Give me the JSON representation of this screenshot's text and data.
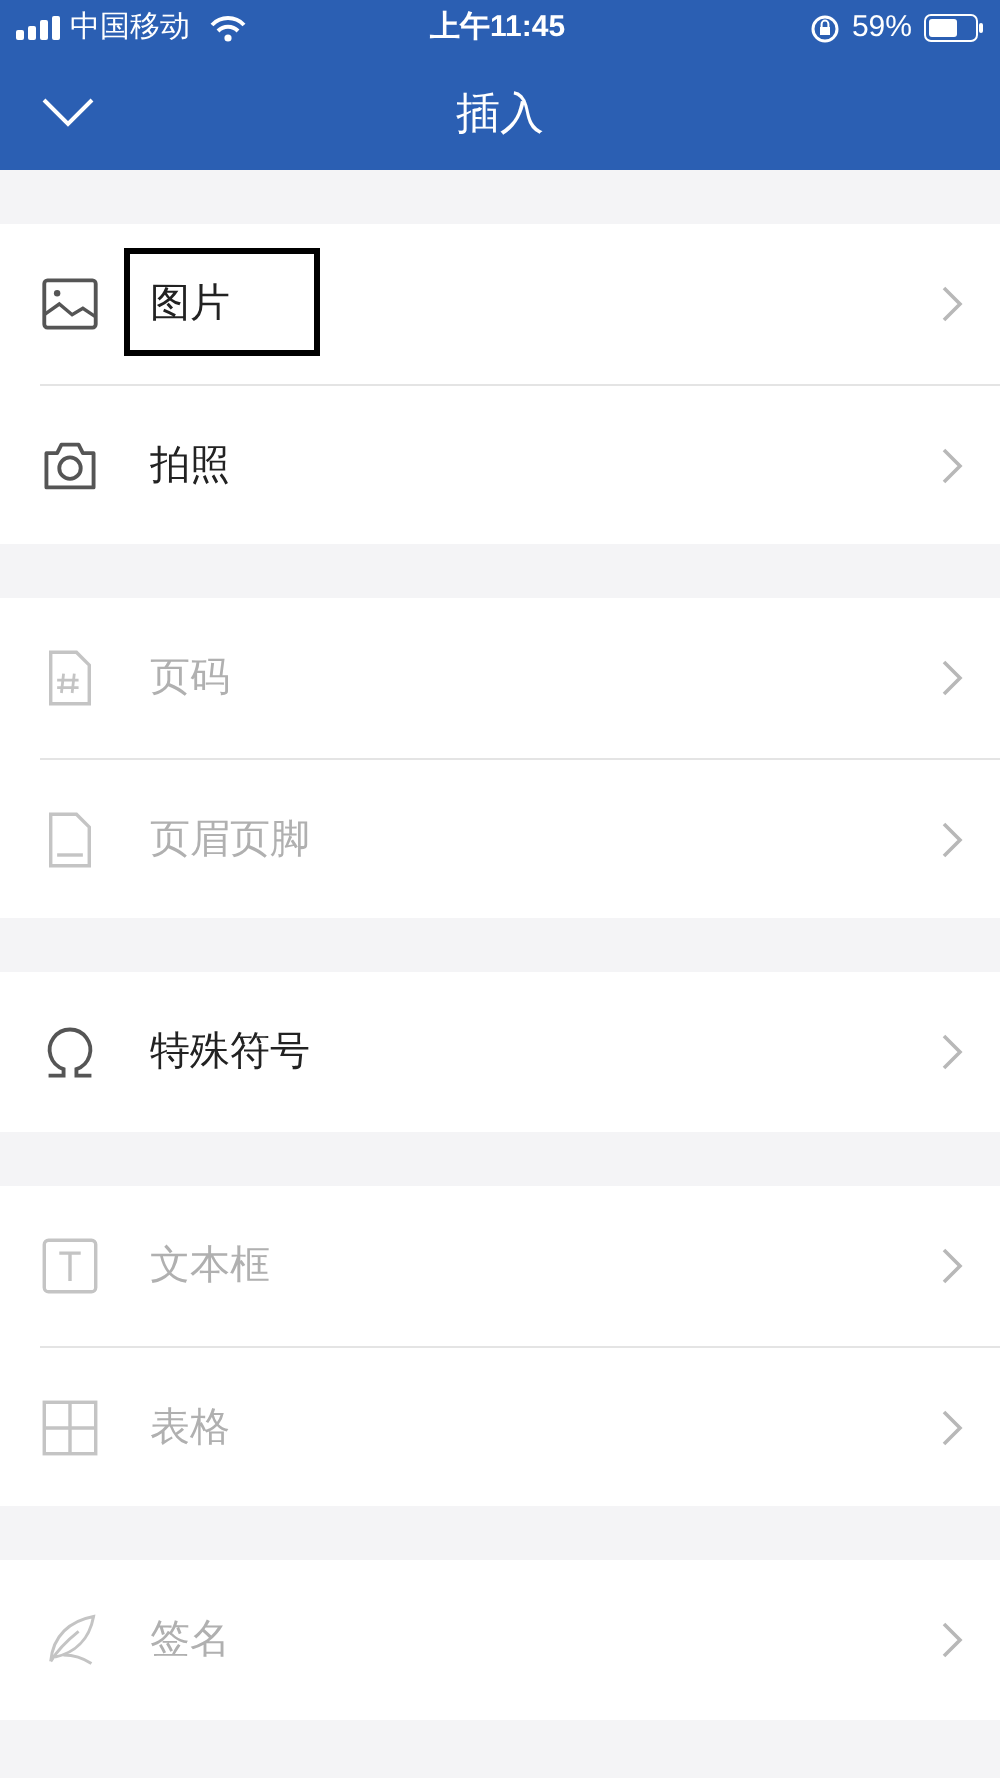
{
  "status_bar": {
    "carrier": "中国移动",
    "time": "上午11:45",
    "battery": "59%"
  },
  "header": {
    "title": "插入"
  },
  "groups": [
    {
      "items": [
        {
          "kind": "picture",
          "label": "图片",
          "disabled": false,
          "highlighted": true
        },
        {
          "kind": "camera",
          "label": "拍照",
          "disabled": false,
          "highlighted": false
        }
      ]
    },
    {
      "items": [
        {
          "kind": "pagenumber",
          "label": "页码",
          "disabled": true,
          "highlighted": false
        },
        {
          "kind": "headerfooter",
          "label": "页眉页脚",
          "disabled": true,
          "highlighted": false
        }
      ]
    },
    {
      "items": [
        {
          "kind": "symbol",
          "label": "特殊符号",
          "disabled": false,
          "highlighted": false
        }
      ]
    },
    {
      "items": [
        {
          "kind": "textbox",
          "label": "文本框",
          "disabled": true,
          "highlighted": false
        },
        {
          "kind": "table",
          "label": "表格",
          "disabled": true,
          "highlighted": false
        }
      ]
    },
    {
      "items": [
        {
          "kind": "signature",
          "label": "签名",
          "disabled": true,
          "highlighted": false
        }
      ]
    }
  ]
}
